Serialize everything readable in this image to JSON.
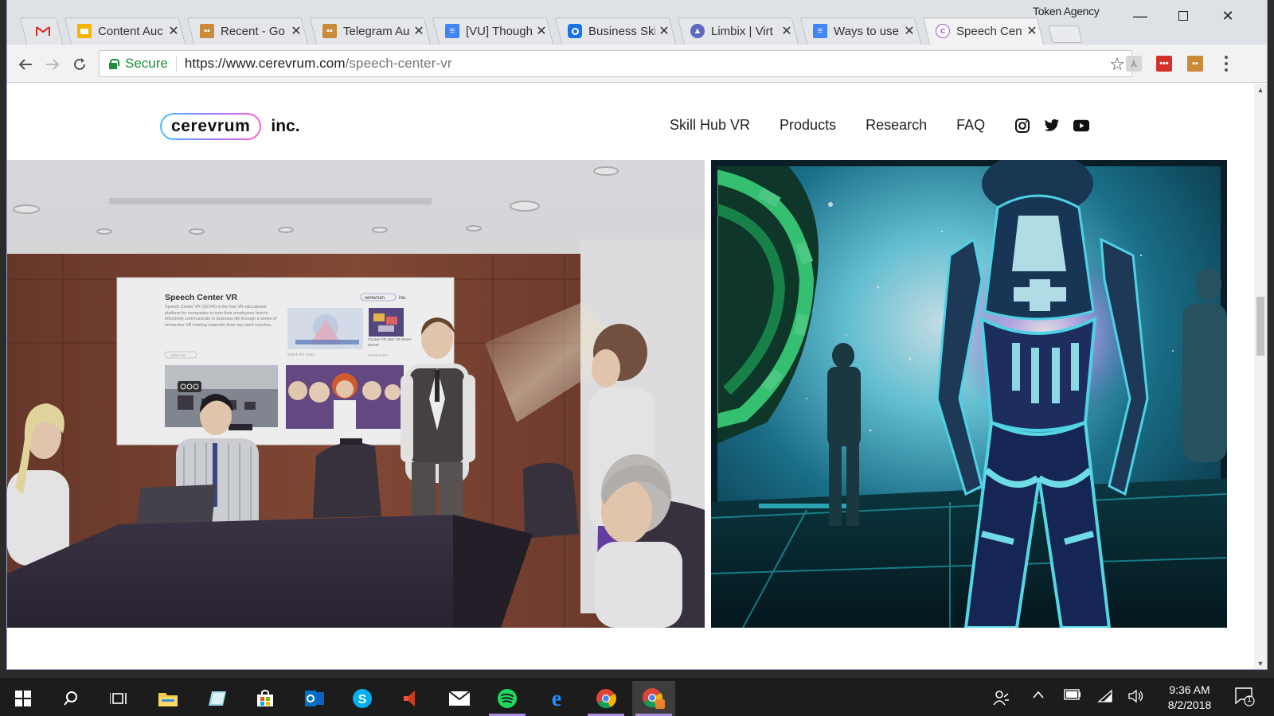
{
  "browser": {
    "profile_name": "Token Agency",
    "tabs": [
      {
        "title": "",
        "favicon": "gmail-icon",
        "color": "#d93025"
      },
      {
        "title": "Content Auc",
        "favicon": "slides-icon",
        "color": "#f4b400"
      },
      {
        "title": "Recent - Go",
        "favicon": "robot-icon",
        "color": "#c98a3a"
      },
      {
        "title": "Telegram Au",
        "favicon": "robot-icon",
        "color": "#c98a3a"
      },
      {
        "title": "[VU] Though",
        "favicon": "docs-icon",
        "color": "#4285f4"
      },
      {
        "title": "Business Ski",
        "favicon": "circle-icon",
        "color": "#1a73e8"
      },
      {
        "title": "Limbix | Virt",
        "favicon": "triangle-icon",
        "color": "#5c6bc0"
      },
      {
        "title": "Ways to use",
        "favicon": "docs-icon",
        "color": "#4285f4"
      },
      {
        "title": "Speech Cen",
        "favicon": "cerevrum-icon",
        "color": "#9c5bd6",
        "active": true
      }
    ],
    "secure_label": "Secure",
    "url_host": "https://www.cerevrum.com",
    "url_path": "/speech-center-vr"
  },
  "site": {
    "logo_text": "cerevrum",
    "logo_suffix": "inc.",
    "nav": [
      "Skill Hub VR",
      "Products",
      "Research",
      "FAQ"
    ],
    "social": [
      "instagram-icon",
      "twitter-icon",
      "youtube-icon"
    ]
  },
  "screen": {
    "title": "Speech Center VR",
    "intro": "Speech Center VR (SCVR) is the first VR educational platform for companies to train their employees how to effectively communicate in business life through a series of immersive VR training materials from top-rated coaches.",
    "visit_label": "Visit now",
    "award_text": "Oculus VR Jam '15 Silver winner",
    "watch_label": "Watch the video",
    "read_label": "Read more",
    "logo_text": "cerevrum",
    "logo_suffix": "inc."
  },
  "taskbar": {
    "time": "9:36 AM",
    "date": "8/2/2018",
    "notification_count": "1"
  }
}
